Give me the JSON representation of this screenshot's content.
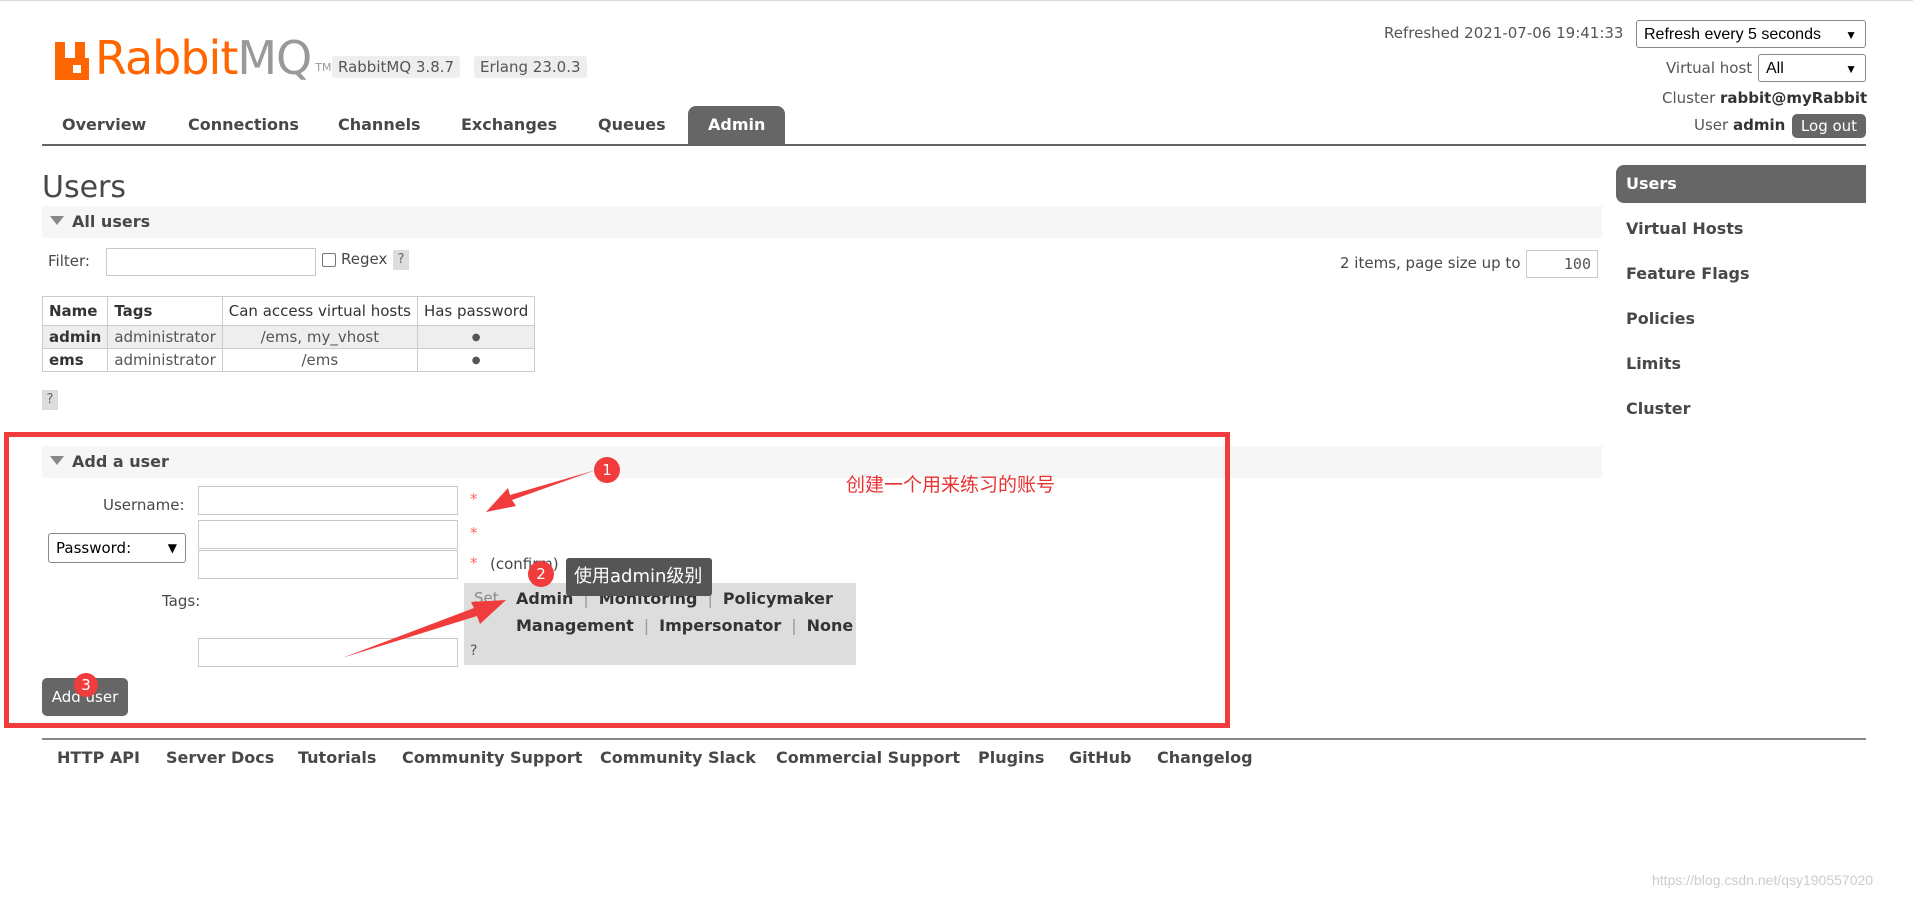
{
  "header": {
    "logo_brand": "Rabbit",
    "logo_brand2": "MQ",
    "logo_tm": "TM",
    "version_rabbit": "RabbitMQ 3.8.7",
    "version_erlang": "Erlang 23.0.3",
    "refreshed_text": "Refreshed 2021-07-06 19:41:33",
    "refresh_select": "Refresh every 5 seconds",
    "virtual_host_label": "Virtual host",
    "virtual_host_select": "All",
    "cluster_label": "Cluster",
    "cluster_value": "rabbit@myRabbit",
    "user_label": "User",
    "user_value": "admin",
    "logout_label": "Log out"
  },
  "tabs": [
    "Overview",
    "Connections",
    "Channels",
    "Exchanges",
    "Queues",
    "Admin"
  ],
  "page_title": "Users",
  "all_users": {
    "section_label": "All users",
    "filter_label": "Filter:",
    "regex_label": "Regex",
    "help": "?",
    "page_info": "2 items, page size up to",
    "page_size": "100",
    "columns": [
      "Name",
      "Tags",
      "Can access virtual hosts",
      "Has password"
    ],
    "rows": [
      {
        "name": "admin",
        "tags": "administrator",
        "vhosts": "/ems, my_vhost",
        "has_password": "●"
      },
      {
        "name": "ems",
        "tags": "administrator",
        "vhosts": "/ems",
        "has_password": "●"
      }
    ]
  },
  "add_user": {
    "section_label": "Add a user",
    "username_label": "Username:",
    "password_select": "Password:",
    "required_mark": "*",
    "confirm_label": "(confirm)",
    "tags_label": "Tags:",
    "set_label": "Set",
    "tag_options_row1": [
      "Admin",
      "Monitoring",
      "Policymaker"
    ],
    "tag_options_row2": [
      "Management",
      "Impersonator",
      "None"
    ],
    "tag_separator": "|",
    "help": "?",
    "add_button": "Add user"
  },
  "annotations": {
    "note": "创建一个用来练习的账号",
    "tooltip": "使用admin级别",
    "badge1": "1",
    "badge2": "2",
    "badge3": "3",
    "highlight_color": "#f03c3c"
  },
  "sidebar": [
    "Users",
    "Virtual Hosts",
    "Feature Flags",
    "Policies",
    "Limits",
    "Cluster"
  ],
  "footer": [
    "HTTP API",
    "Server Docs",
    "Tutorials",
    "Community Support",
    "Community Slack",
    "Commercial Support",
    "Plugins",
    "GitHub",
    "Changelog"
  ],
  "watermark": "https://blog.csdn.net/qsy190557020",
  "colors": {
    "brand": "#ff6600",
    "active_tab": "#666666"
  }
}
